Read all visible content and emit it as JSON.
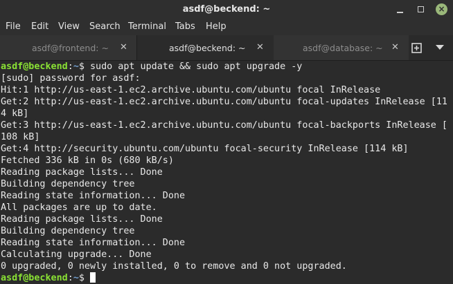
{
  "window": {
    "title": "asdf@beckend: ~"
  },
  "menu": {
    "items": [
      "File",
      "Edit",
      "View",
      "Search",
      "Terminal",
      "Tabs",
      "Help"
    ]
  },
  "tabs": [
    {
      "label": "asdf@frontend: ~",
      "active": false
    },
    {
      "label": "asdf@beckend: ~",
      "active": true
    },
    {
      "label": "asdf@database: ~",
      "active": false
    }
  ],
  "icons": {
    "minimize": "minimize-icon",
    "maximize": "maximize-icon",
    "close": "close-icon",
    "tab_close": "close-icon",
    "new_tab": "new-tab-icon",
    "tab_menu": "chevron-down-icon"
  },
  "colors": {
    "prompt_user": "#8ae234",
    "prompt_path": "#729fcf",
    "text": "#e8e8e8",
    "background": "#2b2b2b",
    "close_button": "#9ab87a"
  },
  "terminal": {
    "prompt_user": "asdf@beckend",
    "prompt_sep": ":",
    "prompt_path": "~",
    "prompt_symbol": "$",
    "command": " sudo apt update && sudo apt upgrade -y",
    "output": [
      "[sudo] password for asdf:",
      "Hit:1 http://us-east-1.ec2.archive.ubuntu.com/ubuntu focal InRelease",
      "Get:2 http://us-east-1.ec2.archive.ubuntu.com/ubuntu focal-updates InRelease [11",
      "4 kB]",
      "Get:3 http://us-east-1.ec2.archive.ubuntu.com/ubuntu focal-backports InRelease [",
      "108 kB]",
      "Get:4 http://security.ubuntu.com/ubuntu focal-security InRelease [114 kB]",
      "Fetched 336 kB in 0s (680 kB/s)",
      "Reading package lists... Done",
      "Building dependency tree",
      "Reading state information... Done",
      "All packages are up to date.",
      "Reading package lists... Done",
      "Building dependency tree",
      "Reading state information... Done",
      "Calculating upgrade... Done",
      "0 upgraded, 0 newly installed, 0 to remove and 0 not upgraded."
    ],
    "final_prompt_symbol": "$ "
  }
}
